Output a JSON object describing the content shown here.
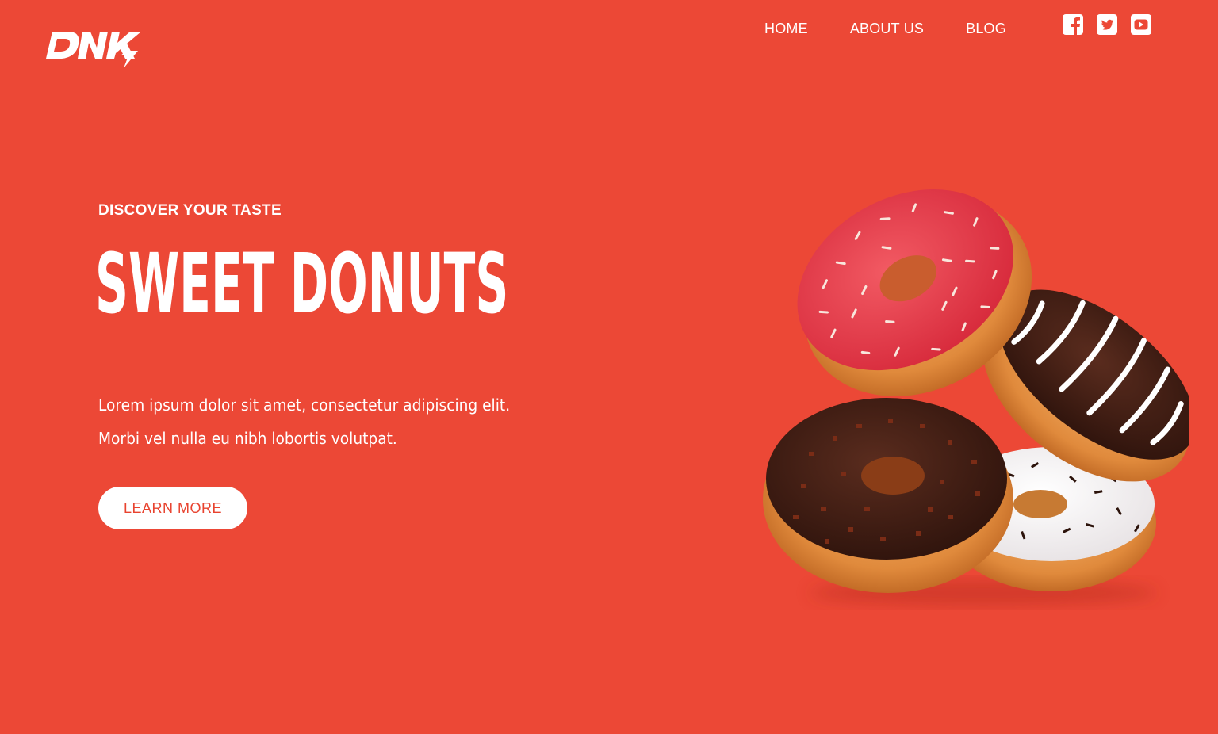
{
  "brand": {
    "logo_text": "DNK",
    "colors": {
      "background": "#ec4836",
      "text": "#ffffff",
      "button_text": "#e8432f"
    }
  },
  "nav": {
    "items": [
      {
        "label": "HOME"
      },
      {
        "label": "ABOUT US"
      },
      {
        "label": "BLOG"
      }
    ]
  },
  "social": [
    {
      "icon": "facebook-icon"
    },
    {
      "icon": "twitter-icon"
    },
    {
      "icon": "youtube-icon"
    }
  ],
  "hero": {
    "eyebrow": "DISCOVER YOUR TASTE",
    "title": "SWEET DONUTS",
    "body_lines": [
      "Lorem ipsum dolor sit amet, consectetur adipiscing elit.",
      "Morbi vel nulla eu nibh lobortis volutpat."
    ],
    "cta_label": "LEARN MORE"
  },
  "illustration": {
    "subject": "stack of four donuts"
  }
}
